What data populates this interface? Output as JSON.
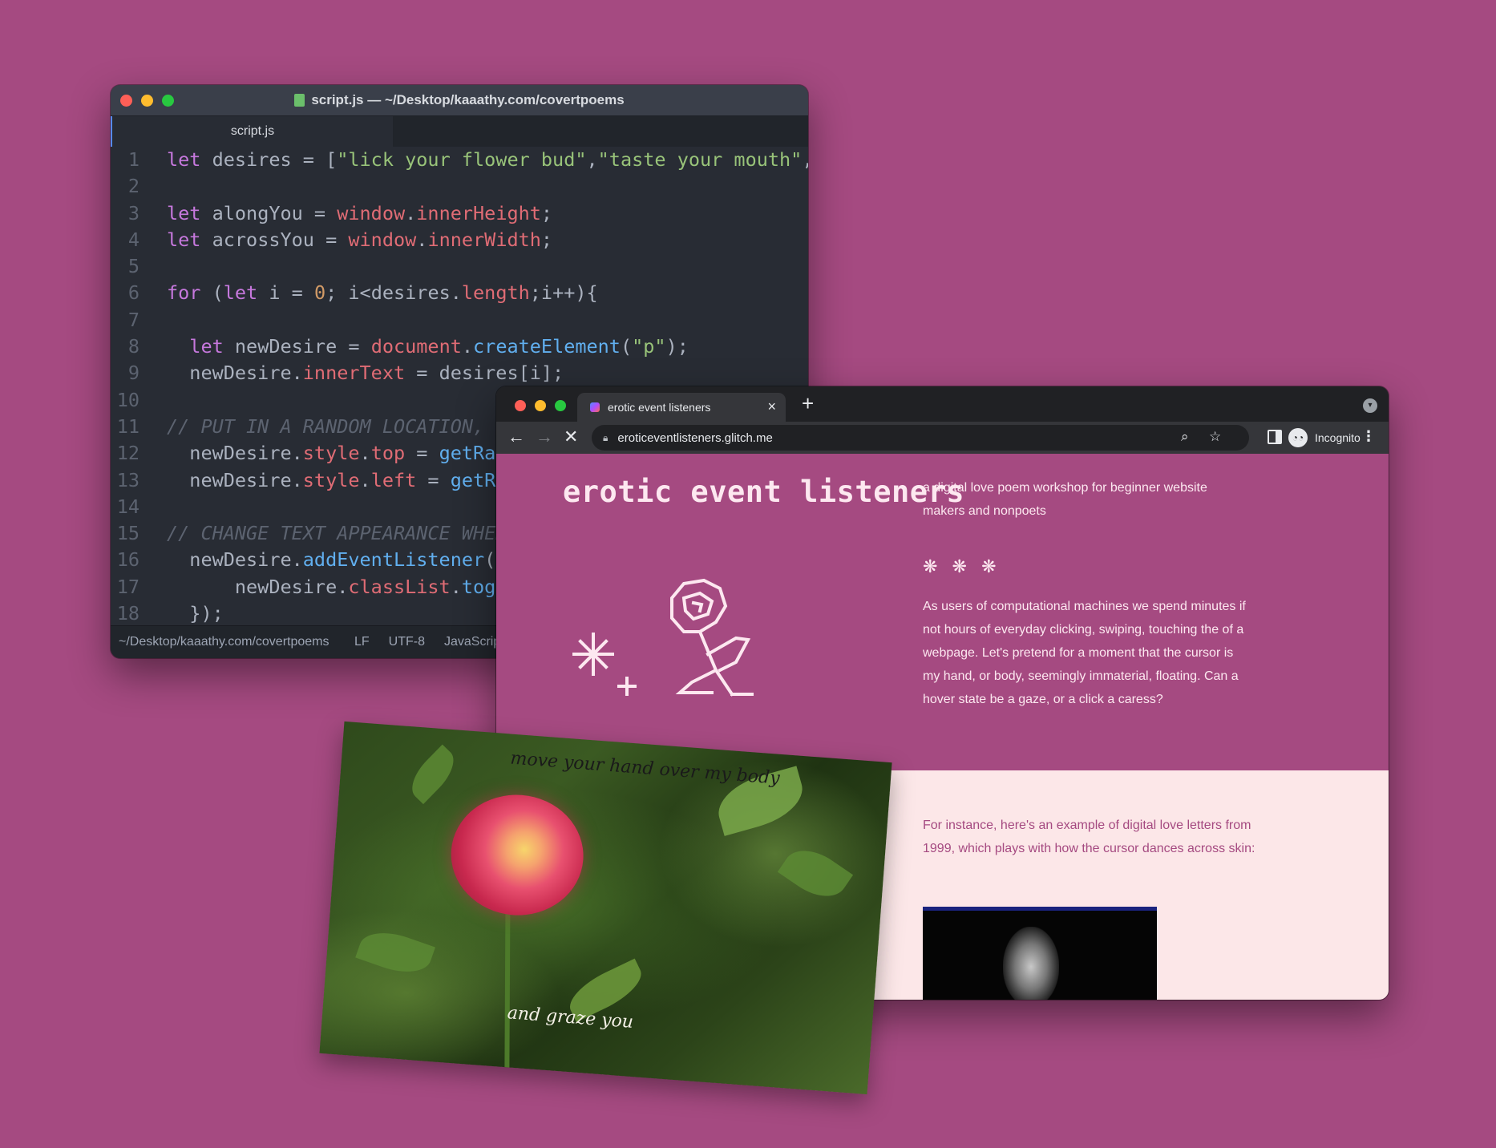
{
  "editor": {
    "title": "script.js — ~/Desktop/kaaathy.com/covertpoems",
    "tab": "script.js",
    "status": {
      "path": "~/Desktop/kaaathy.com/covertpoems",
      "line_ending": "LF",
      "encoding": "UTF-8",
      "language": "JavaScript"
    },
    "line_numbers": [
      "1",
      "2",
      "3",
      "4",
      "5",
      "6",
      "7",
      "8",
      "9",
      "10",
      "11",
      "12",
      "13",
      "14",
      "15",
      "16",
      "17",
      "18"
    ],
    "code": [
      "let desires = [\"lick your flower bud\",\"taste your mouth\",\"e",
      "",
      "let alongYou = window.innerHeight;",
      "let acrossYou = window.innerWidth;",
      "",
      "for (let i = 0; i<desires.length;i++){",
      "",
      "  let newDesire = document.createElement(\"p\");",
      "  newDesire.innerText = desires[i];",
      "",
      "// PUT IN A RANDOM LOCATION, a",
      "  newDesire.style.top = getRan",
      "  newDesire.style.left = getRa",
      "",
      "// CHANGE TEXT APPEARANCE WHEN",
      "  newDesire.addEventListener(\"",
      "      newDesire.classList.togg",
      "  });"
    ]
  },
  "browser": {
    "tab_title": "erotic event listeners",
    "url": "eroticeventlisteners.glitch.me",
    "profile_label": "Incognito",
    "site": {
      "title": "erotic event listeners",
      "intro": "a digital love poem workshop for beginner website makers and nonpoets",
      "stars": "❋ ❋ ❋",
      "paragraph": "As users of computational machines we spend minutes if not hours of everyday clicking, swiping, touching the of a webpage. Let's pretend for a moment that the cursor is my hand, or body, seemingly immaterial, floating. Can a hover state be a gaze, or a click a caress?",
      "example": "For instance, here's an example of digital love letters from 1999, which plays with how the cursor dances across skin:"
    }
  },
  "photo": {
    "caption_top": "move your hand over my body",
    "caption_bottom": "and graze you"
  },
  "colors": {
    "background": "#a54a81",
    "site_light": "#fce7e8",
    "site_text": "#fde8f0"
  }
}
